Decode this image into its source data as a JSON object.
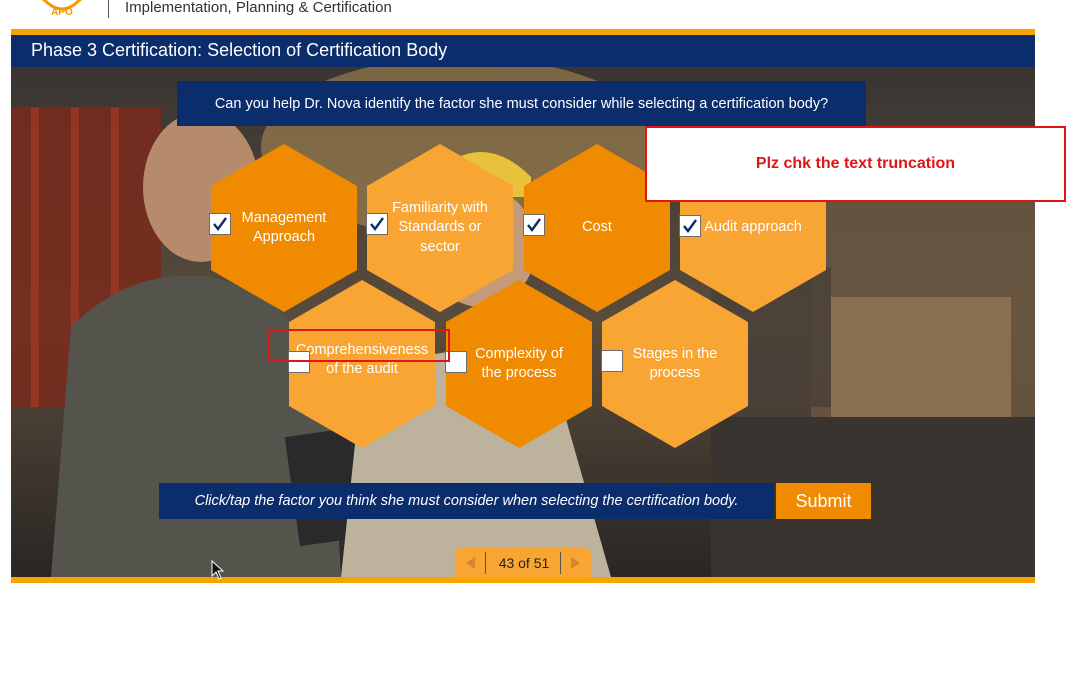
{
  "header": {
    "logo_text": "APO",
    "subtitle": "Implementation, Planning & Certification"
  },
  "slide": {
    "title": "Phase 3 Certification: Selection of Certification Body",
    "question": "Can you help Dr. Nova identify the factor she must consider while selecting a certification body?",
    "options": [
      {
        "label": "Management Approach",
        "checked": true
      },
      {
        "label": "Familiarity with Standards or sector",
        "checked": true
      },
      {
        "label": "Cost",
        "checked": true
      },
      {
        "label": "Audit approach",
        "checked": true
      },
      {
        "label": "Comprehensiveness of the audit",
        "checked": false
      },
      {
        "label": "Complexity of the process",
        "checked": false
      },
      {
        "label": "Stages in the process",
        "checked": false
      }
    ],
    "instruction": "Click/tap the factor you think she must consider when selecting the certification body.",
    "submit_label": "Submit"
  },
  "review_note": "Plz chk the text truncation",
  "pager": {
    "label": "43 of 51",
    "current": 43,
    "total": 51
  },
  "colors": {
    "navy": "#0b2d6c",
    "orange_dark": "#f08a00",
    "orange_light": "#f9a534",
    "accent_bar": "#f7a300",
    "annotation_red": "#e01515"
  }
}
